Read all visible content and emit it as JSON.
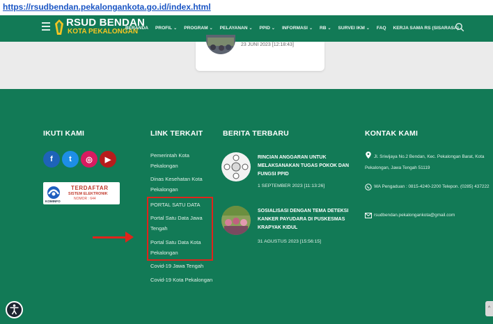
{
  "browser": {
    "url": "https://rsudbendan.pekalongankota.go.id/index.html"
  },
  "header": {
    "logo_title": "RSUD BENDAN",
    "logo_subtitle": "KOTA PEKALONGAN",
    "nav": [
      {
        "label": "BERANDA",
        "dropdown": false
      },
      {
        "label": "PROFIL",
        "dropdown": true
      },
      {
        "label": "PROGRAM",
        "dropdown": true
      },
      {
        "label": "PELAYANAN",
        "dropdown": true
      },
      {
        "label": "PPID",
        "dropdown": true
      },
      {
        "label": "INFORMASI",
        "dropdown": true
      },
      {
        "label": "RB",
        "dropdown": true
      },
      {
        "label": "SURVEI IKM",
        "dropdown": true
      },
      {
        "label": "FAQ",
        "dropdown": false
      },
      {
        "label": "KERJA SAMA RS (SISARASA)",
        "dropdown": false
      }
    ],
    "dropdown_glyph": "⌄"
  },
  "upper_card": {
    "date": "23 JUNI 2023 [12:18:43]"
  },
  "footer": {
    "follow": {
      "heading": "IKUTI KAMI",
      "social": [
        {
          "name": "facebook",
          "glyph": "f",
          "color": "#1e63b8"
        },
        {
          "name": "twitter",
          "glyph": "t",
          "color": "#1d8ee6"
        },
        {
          "name": "instagram",
          "glyph": "◎",
          "color": "#d81b60"
        },
        {
          "name": "youtube",
          "glyph": "▶",
          "color": "#b71c1c"
        }
      ],
      "badge": {
        "top": "TERDAFTAR",
        "middle": "SISTEM ELEKTRONIK",
        "registration": "NOMOR : 644",
        "org": "KOMINFO"
      }
    },
    "links": {
      "heading": "LINK TERKAIT",
      "items": [
        "Pemerintah Kota Pekalongan",
        "Dinas Kesehatan Kota Pekalongan",
        "PORTAL SATU DATA",
        "Portal Satu Data Jawa Tengah",
        "Portal Satu Data Kota Pekalongan",
        "Covid-19 Jawa Tengah",
        "Covid-19 Kota Pekalongan"
      ]
    },
    "news": {
      "heading": "BERITA TERBARU",
      "items": [
        {
          "title": "RINCIAN ANGGARAN UNTUK MELAKSANAKAN TUGAS POKOK DAN FUNGSI PPID",
          "date": "1 SEPTEMBER 2023 [11:13:26]"
        },
        {
          "title": "SOSIALISASI DENGAN TEMA DETEKSI KANKER PAYUDARA DI PUSKESMAS KRAPYAK KIDUL",
          "date": "31 AGUSTUS 2023 [15:56:15]"
        }
      ]
    },
    "contact": {
      "heading": "KONTAK KAMI",
      "address": "Jl. Sriwijaya No.2 Bendan, Kec. Pekalongan Barat, Kota Pekalongan, Jawa Tengah 51119",
      "phone": "WA Pengaduan : 0815-4240-2200 Telepon. (0285) 437222",
      "email": "rsudbendan.pekalongankota@gmail.com"
    }
  },
  "colors": {
    "primary": "#127a56",
    "highlight": "#e0241b",
    "accent": "#f6c522"
  }
}
